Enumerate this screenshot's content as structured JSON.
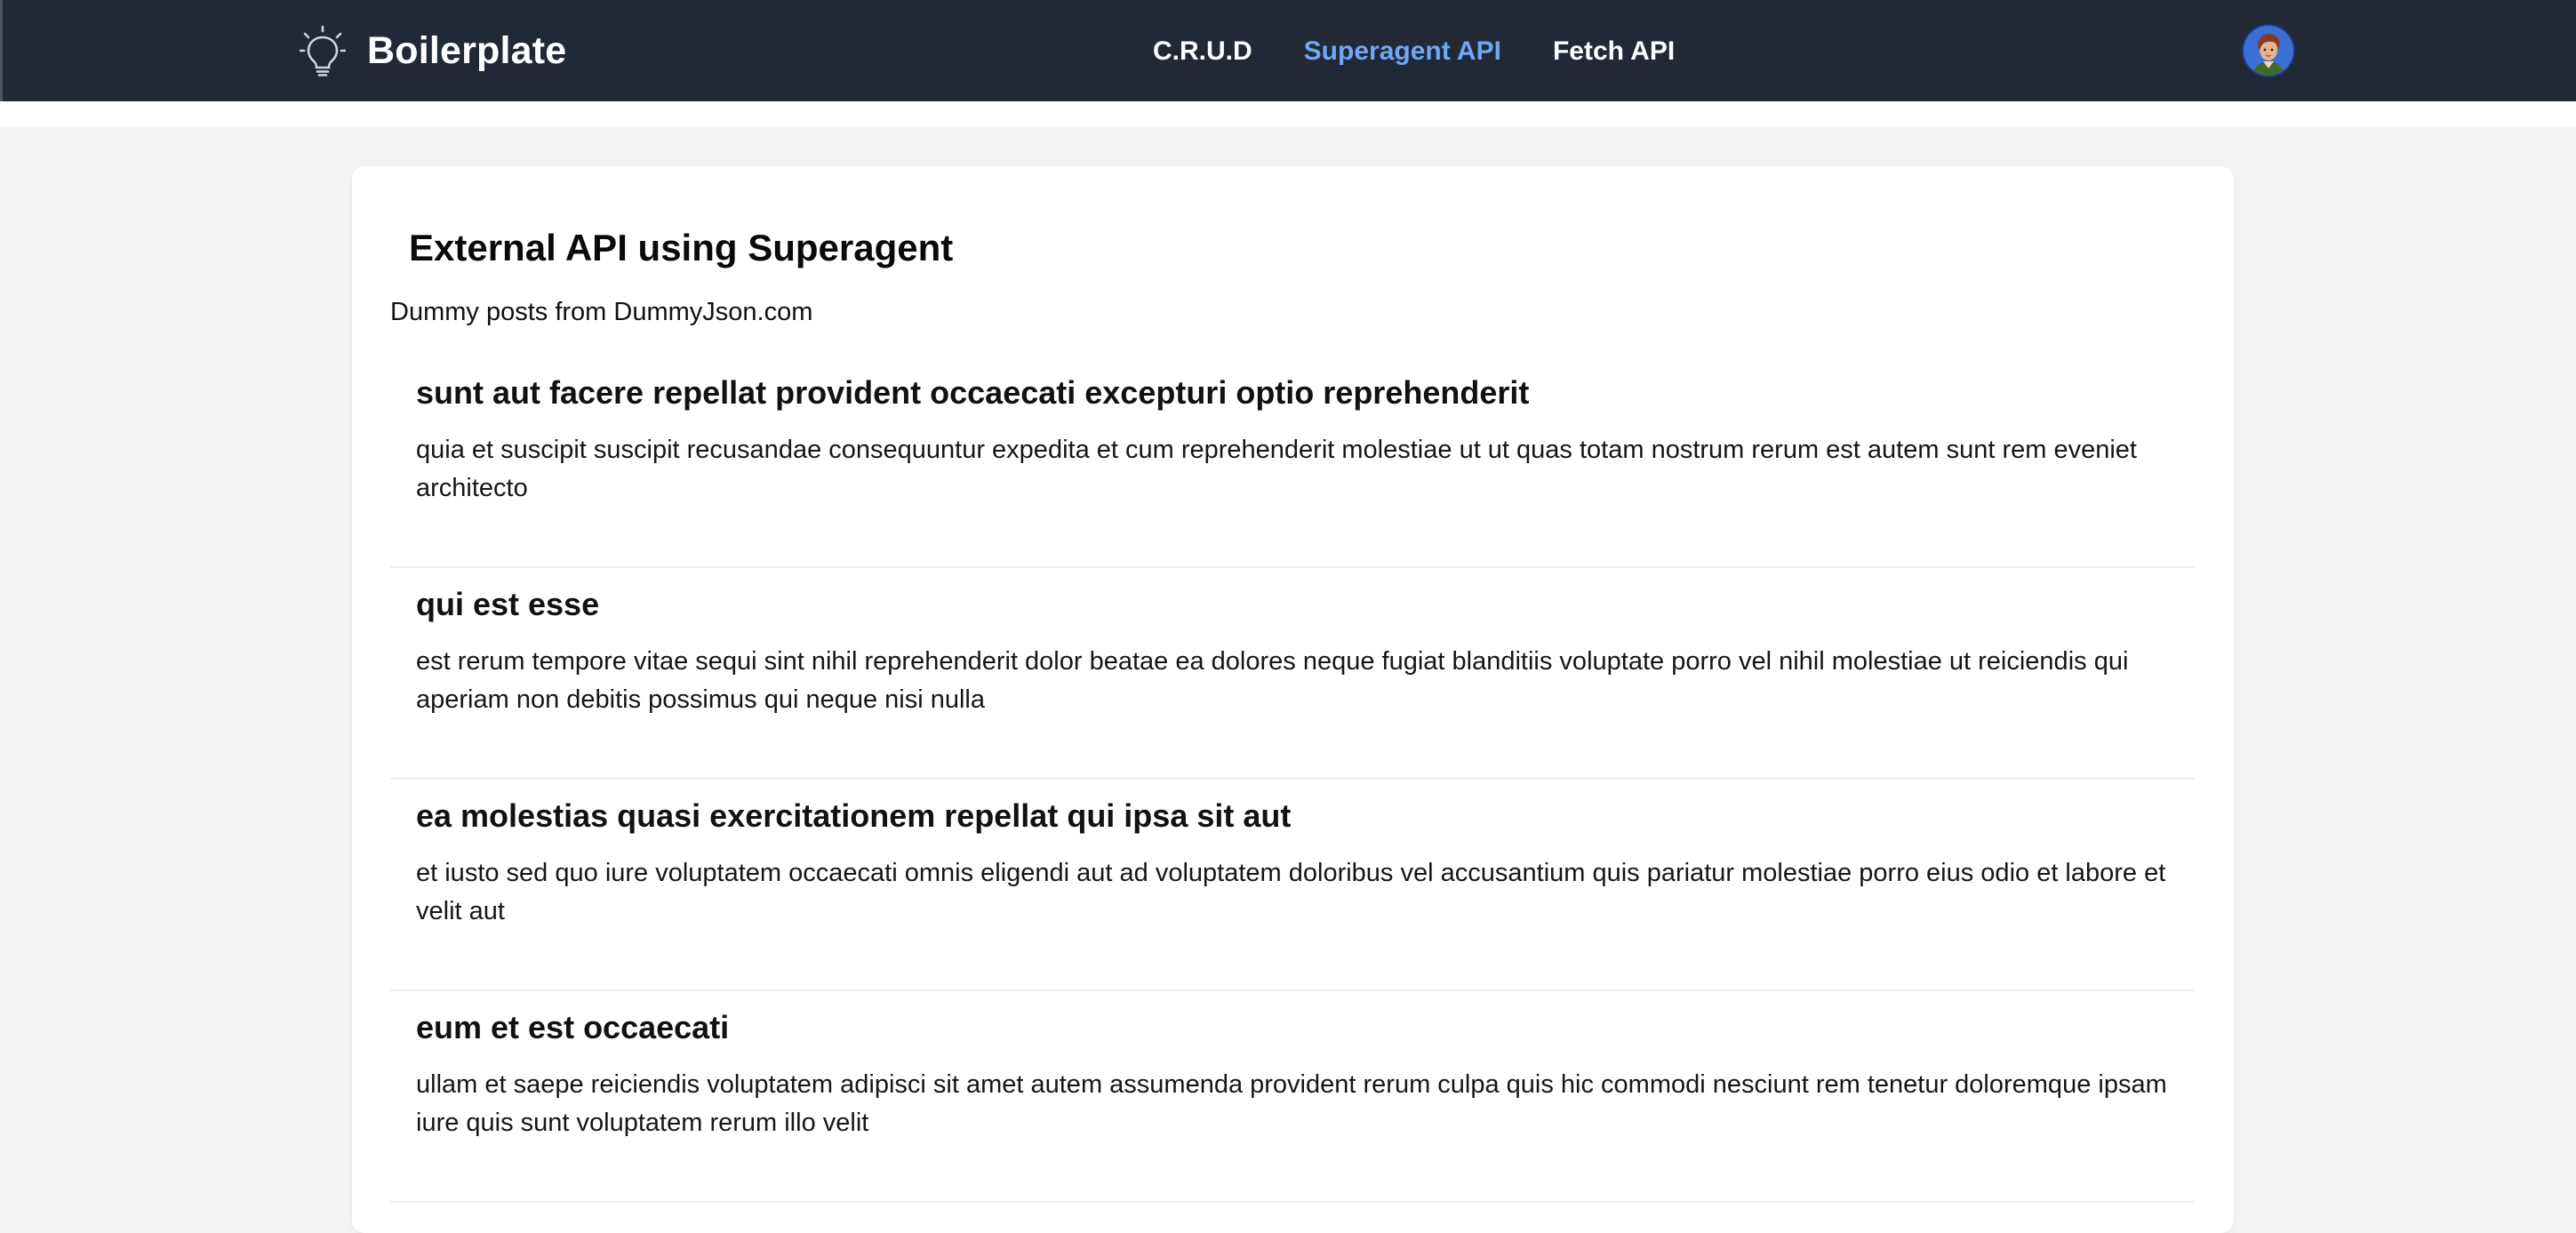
{
  "navbar": {
    "brand_name": "Boilerplate",
    "brand_icon": "lightbulb-icon",
    "links": [
      "C.R.U.D",
      "Superagent API",
      "Fetch API"
    ],
    "active_link": "Superagent API",
    "active_color": "#6fa7f4",
    "background_color": "#222936",
    "avatar": "user-avatar"
  },
  "page": {
    "title": "External API using Superagent",
    "subtitle": "Dummy posts from DummyJson.com",
    "background_color": "#f3f4f6"
  },
  "posts": [
    {
      "title": "sunt aut facere repellat provident occaecati excepturi optio reprehenderit",
      "body": "quia et suscipit suscipit recusandae consequuntur expedita et cum reprehenderit molestiae ut ut quas totam nostrum rerum est autem sunt rem eveniet architecto"
    },
    {
      "title": "qui est esse",
      "body": "est rerum tempore vitae sequi sint nihil reprehenderit dolor beatae ea dolores neque fugiat blanditiis voluptate porro vel nihil molestiae ut reiciendis qui aperiam non debitis possimus qui neque nisi nulla"
    },
    {
      "title": "ea molestias quasi exercitationem repellat qui ipsa sit aut",
      "body": "et iusto sed quo iure voluptatem occaecati omnis eligendi aut ad voluptatem doloribus vel accusantium quis pariatur molestiae porro eius odio et labore et velit aut"
    },
    {
      "title": "eum et est occaecati",
      "body": "ullam et saepe reiciendis voluptatem adipisci sit amet autem assumenda provident rerum culpa quis hic commodi nesciunt rem tenetur doloremque ipsam iure quis sunt voluptatem rerum illo velit"
    }
  ]
}
